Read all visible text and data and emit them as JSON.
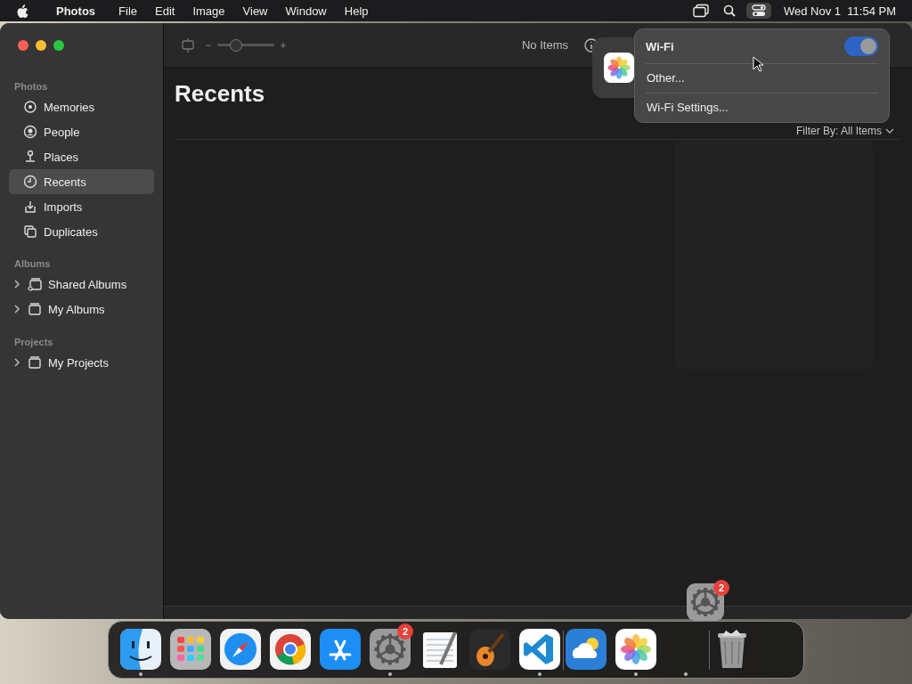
{
  "menu_bar": {
    "app_name": "Photos",
    "menus": [
      "File",
      "Edit",
      "Image",
      "View",
      "Window",
      "Help"
    ],
    "clock": "Wed Nov 1  11:54 PM"
  },
  "window": {
    "toolbar": {
      "zoom": {
        "level": 0.33
      },
      "item_count": "No Items"
    },
    "sidebar": {
      "sections": [
        {
          "title": "Photos",
          "items": [
            {
              "label": "Memories",
              "kind": "memories",
              "selected": false
            },
            {
              "label": "People",
              "kind": "people",
              "selected": false
            },
            {
              "label": "Places",
              "kind": "places",
              "selected": false
            },
            {
              "label": "Recents",
              "kind": "recents",
              "selected": true
            },
            {
              "label": "Imports",
              "kind": "imports",
              "selected": false
            },
            {
              "label": "Duplicates",
              "kind": "duplicates",
              "selected": false
            }
          ]
        },
        {
          "title": "Albums",
          "items": [
            {
              "label": "Shared Albums",
              "kind": "shared-albums",
              "selected": false,
              "expanded": false
            },
            {
              "label": "My Albums",
              "kind": "folder",
              "selected": false,
              "expanded": false
            }
          ]
        },
        {
          "title": "Projects",
          "items": [
            {
              "label": "My Projects",
              "kind": "folder",
              "selected": false,
              "expanded": false
            }
          ]
        }
      ]
    },
    "content": {
      "title": "Recents",
      "filter": "Filter By: All Items"
    }
  },
  "notification": {
    "kind": "photos"
  },
  "wifi_menu": {
    "title": "Wi-Fi",
    "on": true,
    "items": [
      "Other...",
      "Wi-Fi Settings..."
    ]
  },
  "dock": {
    "items": [
      {
        "kind": "finder",
        "running": true
      },
      {
        "kind": "launchpad",
        "running": false
      },
      {
        "kind": "safari",
        "running": false
      },
      {
        "kind": "chrome",
        "running": false
      },
      {
        "kind": "appstore",
        "running": false
      },
      {
        "kind": "settings",
        "running": true,
        "badge": "2"
      },
      {
        "kind": "textedit",
        "running": false
      },
      {
        "kind": "garageband",
        "running": false
      },
      {
        "kind": "vscode",
        "running": true
      },
      {
        "kind": "separator"
      },
      {
        "kind": "weather",
        "running": false
      },
      {
        "kind": "photos",
        "running": true
      },
      {
        "kind": "empty",
        "running": true
      },
      {
        "kind": "separator"
      },
      {
        "kind": "trash",
        "running": false
      }
    ],
    "dragged": {
      "kind": "settings",
      "badge": "2"
    }
  }
}
